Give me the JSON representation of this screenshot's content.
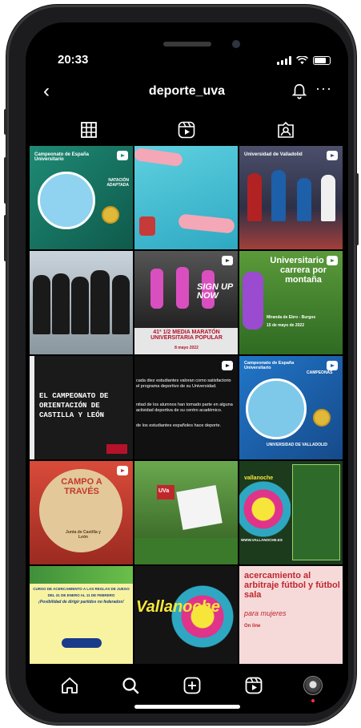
{
  "status_bar": {
    "time": "20:33"
  },
  "header": {
    "username": "deporte_uva",
    "back_icon": "‹",
    "more_icon": "···"
  },
  "posts": [
    {
      "title": "Campeonato de España Universitario",
      "sub": "NATACIÓN ADAPTADA",
      "bg": "#1e7a6b"
    },
    {
      "title": "",
      "sub": "",
      "bg": "#3fb5c9"
    },
    {
      "title": "Universidad de Valladolid",
      "sub": "",
      "bg": "#3a3f5a"
    },
    {
      "title": "",
      "sub": "",
      "bg": "#4a5a6b"
    },
    {
      "title": "SIGN UP NOW",
      "sub": "41ª 1/2 MEDIA MARATÓN UNIVERSITARIA POPULAR",
      "sub2": "8 mayo 2022",
      "bg": "#e8e8e8"
    },
    {
      "title": "Universitario de carrera por montaña",
      "sub": "Miranda de Ebro - Burgos",
      "sub2": "15 de mayo de 2022",
      "bg": "#3f8b3a"
    },
    {
      "title": "EL CAMPEONATO DE ORIENTACIÓN DE CASTILLA Y LEÓN",
      "sub": "",
      "bg": "#1a1a1a"
    },
    {
      "title": "cada diez estudiantes valoran como satisfactorio el programa deportivo de su Universidad.",
      "sub": "nitad de los alumnos han tomado parte en alguna actividad deportiva de su centro académico.",
      "sub2": "de los estudiantes españoles hace deporte.",
      "bg": "#111111"
    },
    {
      "title": "Campeonato de España Universitario",
      "sub": "CAMPEONAS",
      "sub2": "UNIVERSIDAD DE VALLADOLID",
      "bg": "#1d63b0"
    },
    {
      "title": "CAMPO A TRAVÉS",
      "sub": "Junta de Castilla y León",
      "bg": "#c9312a"
    },
    {
      "title": "UVa",
      "sub": "",
      "bg": "#3f7a2a"
    },
    {
      "title": "vallanoche",
      "sub": "WWW.VALLANOCHE.ES",
      "bg": "#1c3a1c"
    },
    {
      "title": "CURSO DE ACERCAMIENTO A LAS REGLAS DE JUEGO",
      "sub": "DEL 31 DE ENERO AL 11 DE FEBRERO",
      "sub2": "¡Posibilidad de dirigir partidos no federados!",
      "bg": "#f2ee3a"
    },
    {
      "title": "Vallanoche",
      "sub": "",
      "bg": "#141414"
    },
    {
      "title": "acercamiento al arbitraje fútbol y fútbol sala",
      "sub": "para mujeres",
      "sub2": "On line",
      "bg": "#f3c9c9"
    }
  ],
  "colors": {
    "background": "#000000",
    "text": "#ffffff",
    "notification_dot": "#ff3040"
  },
  "icons": {
    "back": "chevron-left-icon",
    "bell": "bell-icon",
    "more": "more-icon",
    "grid": "grid-icon",
    "reels": "reels-icon",
    "tagged": "tagged-icon",
    "home": "home-icon",
    "search": "search-icon",
    "create": "plus-square-icon",
    "reels_nav": "reels-icon",
    "profile": "avatar"
  }
}
